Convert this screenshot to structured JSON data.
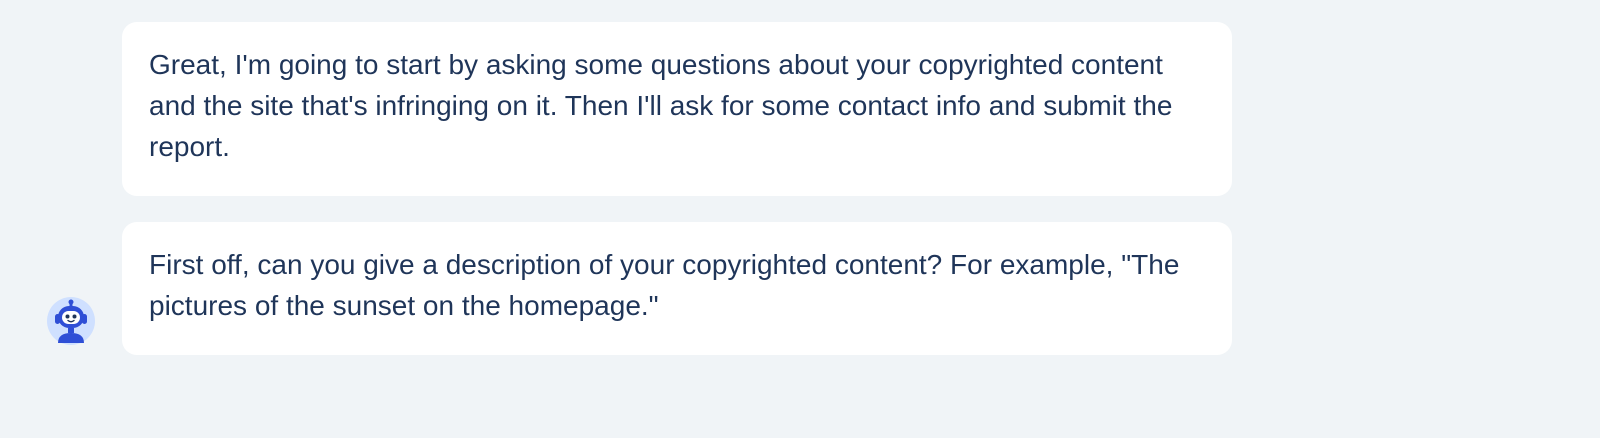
{
  "messages": [
    {
      "sender": "bot",
      "text": "Great, I'm going to start by asking some questions about your copyrighted content and the site that's infringing on it. Then I'll ask for some contact info and submit the report."
    },
    {
      "sender": "bot",
      "text": "First off, can you give a description of your copyrighted content? For example, \"The pictures of the sunset on the homepage.\""
    }
  ],
  "avatar": {
    "icon": "robot-icon",
    "color": "#3b5bdb",
    "background": "#cfe0ff"
  },
  "colors": {
    "page_background": "#f0f4f7",
    "bubble_background": "#ffffff",
    "text": "#1f3559"
  }
}
